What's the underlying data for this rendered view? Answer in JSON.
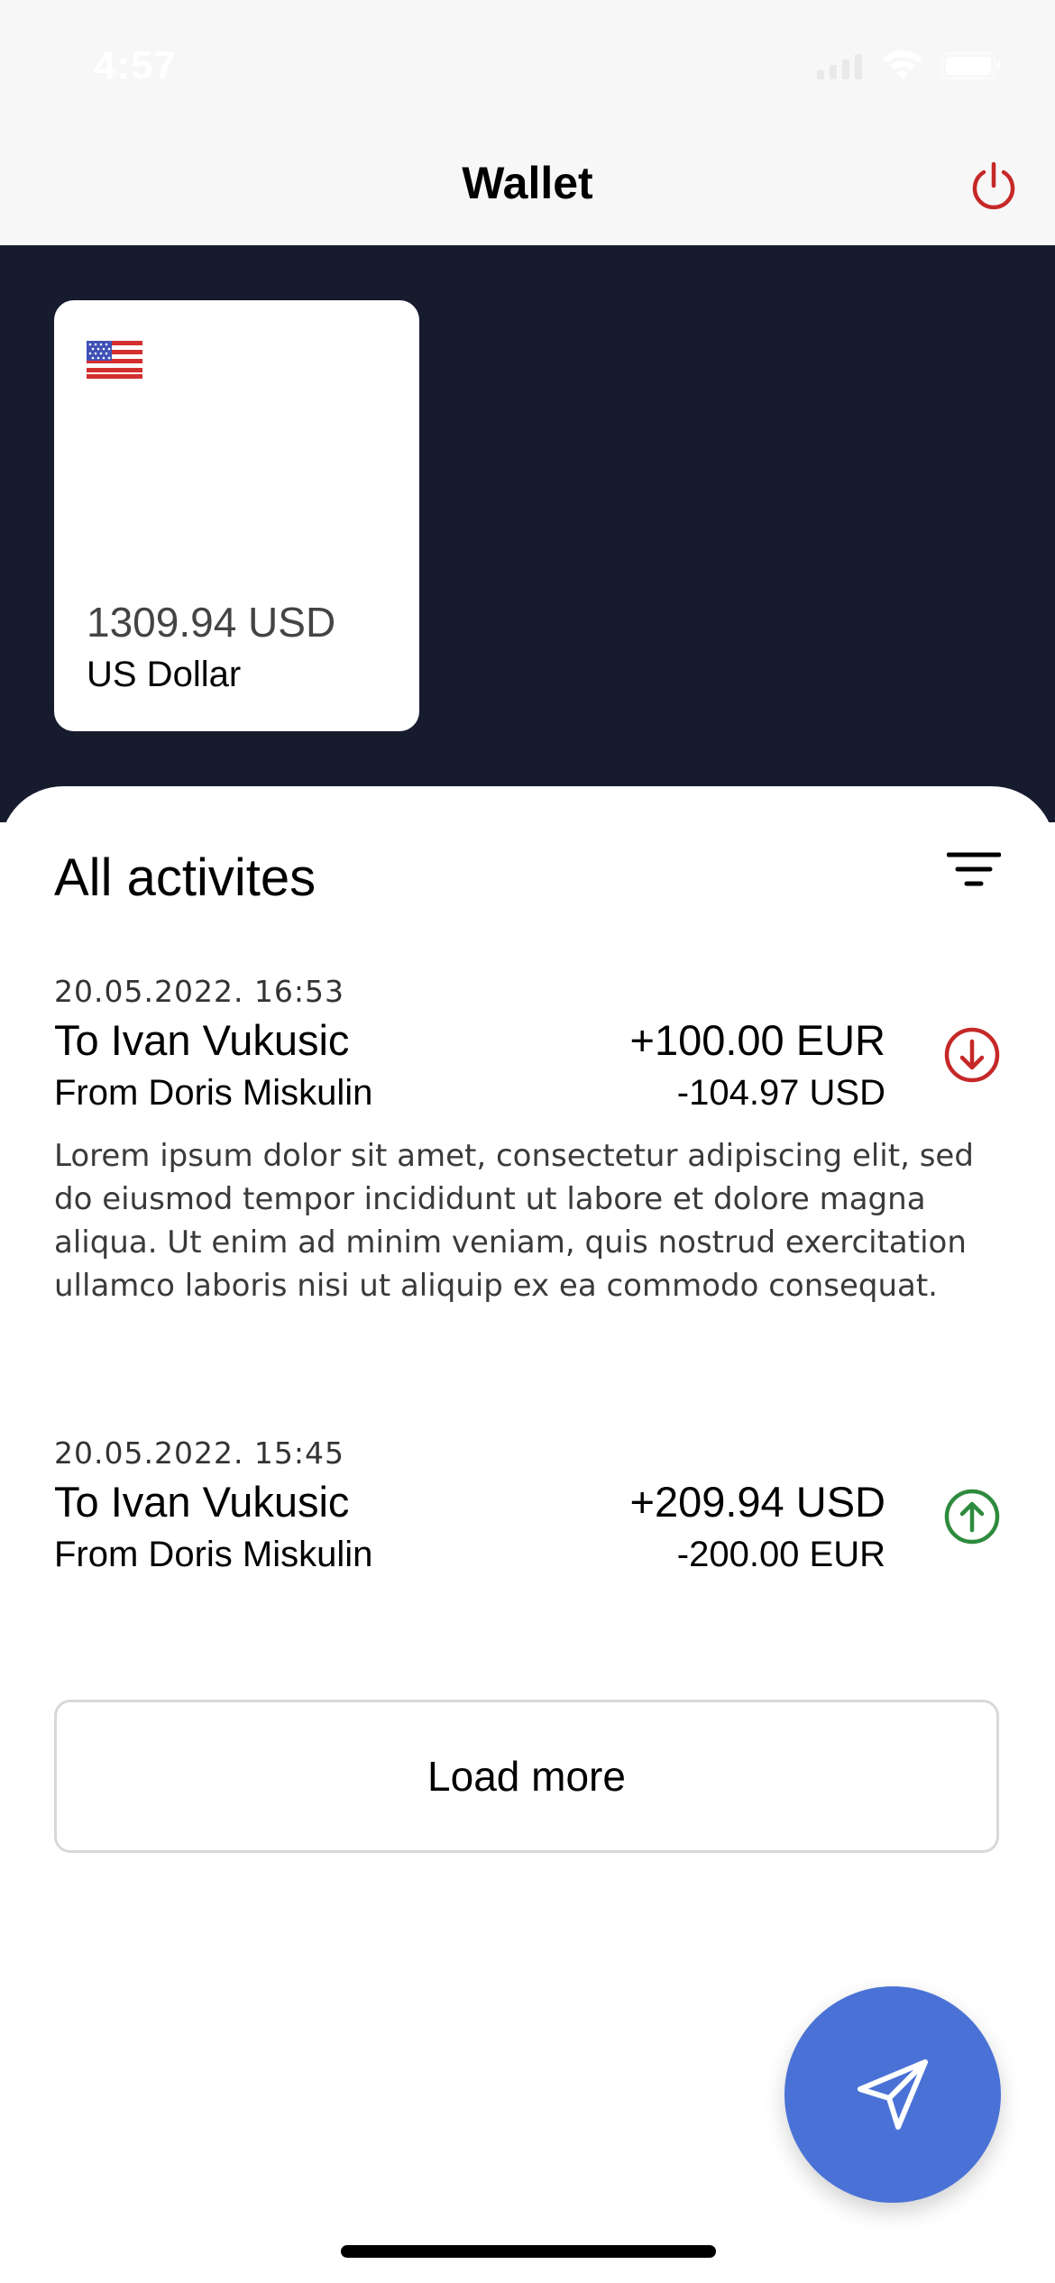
{
  "status_bar": {
    "time": "4:57"
  },
  "nav": {
    "title": "Wallet",
    "logout_icon": "power-icon",
    "logout_color": "#c62828"
  },
  "card": {
    "flag_icon": "us-flag-icon",
    "amount": "1309.94 USD",
    "currency_name": "US Dollar"
  },
  "activities": {
    "title": "All activites",
    "filter_icon": "filter-icon",
    "items": [
      {
        "date": "20.05.2022. 16:53",
        "to": "To Ivan Vukusic",
        "from": "From Doris Miskulin",
        "amount_primary": "+100.00 EUR",
        "amount_secondary": "-104.97 USD",
        "direction_icon": "arrow-down-circle-icon",
        "direction_color": "#c62828",
        "description": "Lorem ipsum dolor sit amet, consectetur adipiscing elit, sed do eiusmod tempor incididunt ut labore et dolore magna aliqua. Ut enim ad minim veniam, quis nostrud exercitation ullamco laboris nisi ut aliquip ex ea commodo consequat."
      },
      {
        "date": "20.05.2022. 15:45",
        "to": "To Ivan Vukusic",
        "from": "From Doris Miskulin",
        "amount_primary": "+209.94 USD",
        "amount_secondary": "-200.00 EUR",
        "direction_icon": "arrow-up-circle-icon",
        "direction_color": "#2e8b3e"
      }
    ],
    "load_more_label": "Load more"
  },
  "fab": {
    "icon": "send-icon",
    "color": "#4a72d6"
  },
  "colors": {
    "header_dark": "#161b2e",
    "nav_bg": "#f7f7f7"
  }
}
